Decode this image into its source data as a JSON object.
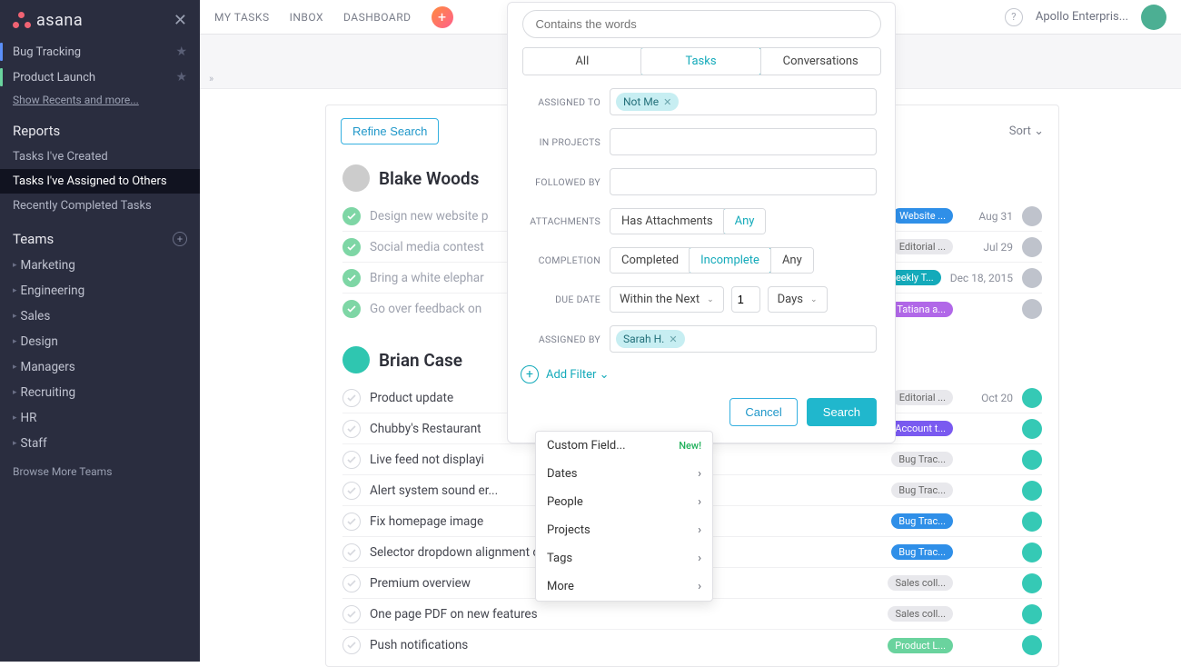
{
  "brand": "asana",
  "sidebar": {
    "recents": [
      {
        "label": "Bug Tracking",
        "color": "#5b8ff9"
      },
      {
        "label": "Product Launch",
        "color": "#6ad39e"
      }
    ],
    "recents_more": "Show Recents and more...",
    "reports_header": "Reports",
    "reports": [
      {
        "label": "Tasks I've Created"
      },
      {
        "label": "Tasks I've Assigned to Others"
      },
      {
        "label": "Recently Completed Tasks"
      }
    ],
    "teams_header": "Teams",
    "teams": [
      {
        "label": "Marketing"
      },
      {
        "label": "Engineering"
      },
      {
        "label": "Sales"
      },
      {
        "label": "Design"
      },
      {
        "label": "Managers"
      },
      {
        "label": "Recruiting"
      },
      {
        "label": "HR"
      },
      {
        "label": "Staff"
      }
    ],
    "browse_more": "Browse More Teams"
  },
  "topbar": {
    "nav": [
      "MY TASKS",
      "INBOX",
      "DASHBOARD"
    ],
    "workspace": "Apollo Enterpris..."
  },
  "panel": {
    "refine": "Refine Search",
    "sort": "Sort ⌄",
    "groups": [
      {
        "name": "Blake Woods",
        "avatar_class": "",
        "tasks": [
          {
            "title": "Design new website p",
            "done": true,
            "tags": [
              {
                "text": "",
                "color": "#ff5b6a",
                "slot": true
              },
              {
                "text": "Website ...",
                "color": "#2f8fe8"
              }
            ],
            "date": "Aug 31"
          },
          {
            "title": "Social media contest",
            "done": true,
            "tags": [
              {
                "text": "",
                "color": "#2fc6b0",
                "slot": true
              },
              {
                "text": "Editorial ...",
                "color": "#e8e8ec",
                "fg": "#666"
              }
            ],
            "date": "Jul 29"
          },
          {
            "title": "Bring a white elephar",
            "done": true,
            "tags": [
              {
                "text": "eekly T...",
                "color": "#14aaba"
              }
            ],
            "date": "Dec 18, 2015"
          },
          {
            "title": "Go over feedback on",
            "done": true,
            "tags": [
              {
                "text": "Tatiana a...",
                "color": "#b168e8"
              }
            ],
            "date": ""
          }
        ]
      },
      {
        "name": "Brian Case",
        "avatar_class": "teal",
        "tasks": [
          {
            "title": "Product update",
            "done": false,
            "tags": [
              {
                "text": "Editorial ...",
                "color": "#e8e8ec",
                "fg": "#666"
              }
            ],
            "date": "Oct 20",
            "teal": true
          },
          {
            "title": "Chubby's Restaurant",
            "done": false,
            "tags": [
              {
                "text": "Account t...",
                "color": "#7a5af0"
              }
            ],
            "date": "",
            "teal": true
          },
          {
            "title": "Live feed not displayi",
            "done": false,
            "tags": [
              {
                "text": "Bug Trac...",
                "color": "#e8e8ec",
                "fg": "#666"
              }
            ],
            "date": "",
            "teal": true
          },
          {
            "title": "Alert system sound er...",
            "done": false,
            "tags": [
              {
                "text": "Bug Trac...",
                "color": "#e8e8ec",
                "fg": "#666"
              }
            ],
            "date": "",
            "teal": true
          },
          {
            "title": "Fix homepage image",
            "done": false,
            "tags": [
              {
                "text": "Bug Trac...",
                "color": "#2f8fe8"
              }
            ],
            "date": "",
            "teal": true
          },
          {
            "title": "Selector dropdown alignment of",
            "done": false,
            "tags": [
              {
                "text": "Bug Trac...",
                "color": "#2f8fe8"
              }
            ],
            "date": "",
            "teal": true
          },
          {
            "title": "Premium overview",
            "done": false,
            "tags": [
              {
                "text": "Sales coll...",
                "color": "#e8e8ec",
                "fg": "#666"
              }
            ],
            "date": "",
            "teal": true
          },
          {
            "title": "One page PDF on new features",
            "done": false,
            "tags": [
              {
                "text": "Sales coll...",
                "color": "#e8e8ec",
                "fg": "#666"
              }
            ],
            "date": "",
            "teal": true
          },
          {
            "title": "Push notifications",
            "done": false,
            "tags": [
              {
                "text": "Product L...",
                "color": "#6ad39e"
              }
            ],
            "date": "",
            "teal": true
          }
        ]
      }
    ]
  },
  "search": {
    "placeholder": "Contains the words",
    "tabs": [
      "All",
      "Tasks",
      "Conversations"
    ],
    "filters": {
      "assigned_to_label": "ASSIGNED TO",
      "assigned_to_chip": "Not Me",
      "in_projects_label": "IN PROJECTS",
      "followed_by_label": "FOLLOWED BY",
      "attachments_label": "ATTACHMENTS",
      "attachments_opts": [
        "Has Attachments",
        "Any"
      ],
      "completion_label": "COMPLETION",
      "completion_opts": [
        "Completed",
        "Incomplete",
        "Any"
      ],
      "due_date_label": "DUE DATE",
      "due_sel": "Within the Next",
      "due_num": "1",
      "due_unit": "Days",
      "assigned_by_label": "ASSIGNED BY",
      "assigned_by_chip": "Sarah H."
    },
    "add_filter": "Add Filter ⌄",
    "cancel": "Cancel",
    "search_btn": "Search",
    "menu": [
      {
        "label": "Custom Field...",
        "badge": "New!"
      },
      {
        "label": "Dates",
        "arrow": true
      },
      {
        "label": "People",
        "arrow": true
      },
      {
        "label": "Projects",
        "arrow": true
      },
      {
        "label": "Tags",
        "arrow": true
      },
      {
        "label": "More",
        "arrow": true
      }
    ]
  }
}
